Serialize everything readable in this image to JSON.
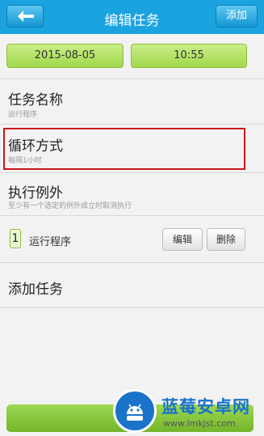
{
  "header": {
    "back_icon": "back-arrow-icon",
    "title": "编辑任务",
    "add_label": "添加",
    "color": "#1ba3e0"
  },
  "datetime": {
    "date": "2015-08-05",
    "time": "10:55"
  },
  "task_name": {
    "title": "任务名称",
    "value": "运行程序"
  },
  "repeat_mode": {
    "title": "循环方式",
    "value": "每隔1小时",
    "highlight_color": "#c8191f"
  },
  "exceptions": {
    "title": "执行例外",
    "subtitle": "至少有一个选定的例外成立时取消执行",
    "items": [
      {
        "number": "1",
        "label": "运行程序",
        "edit_label": "编辑",
        "delete_label": "删除"
      }
    ]
  },
  "add_task": {
    "title": "添加任务"
  },
  "watermark": {
    "title": "蓝莓安卓网",
    "url": "www.lmkjst.com",
    "icon": "android-logo-icon"
  }
}
